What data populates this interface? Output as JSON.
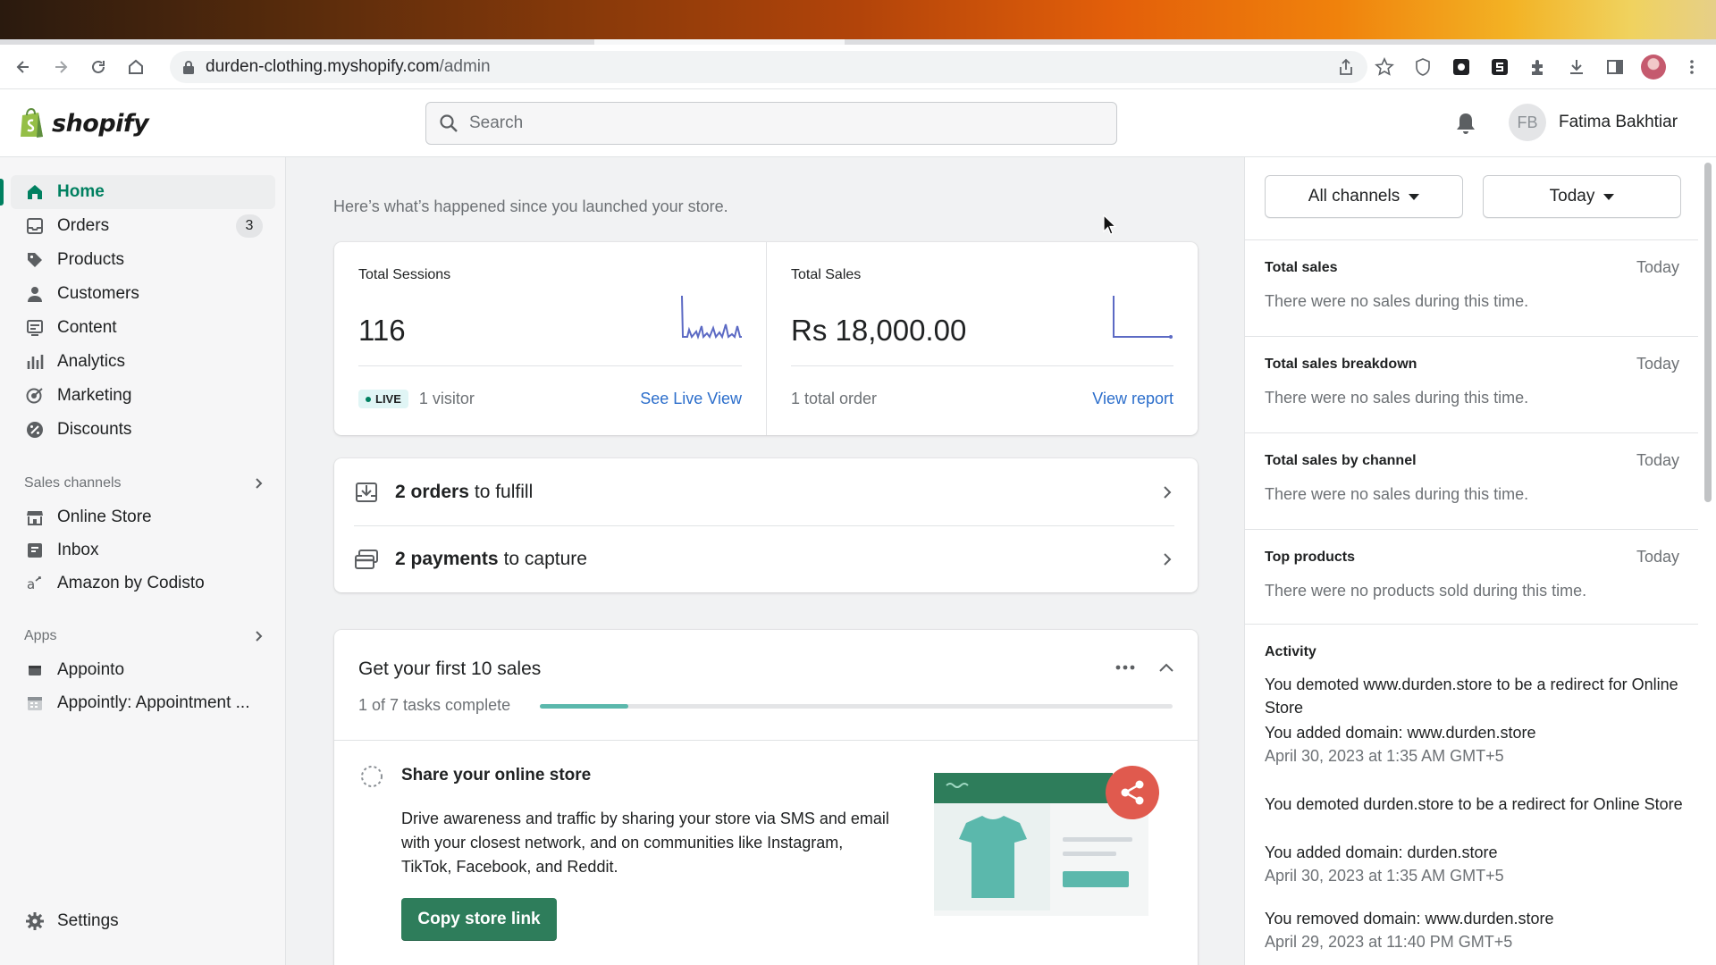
{
  "browser": {
    "url_host": "durden-clothing.myshopify.com",
    "url_path": "/admin"
  },
  "topbar": {
    "logo_text": "shopify",
    "search_placeholder": "Search",
    "user_initials": "FB",
    "user_name": "Fatima Bakhtiar"
  },
  "sidebar": {
    "items": [
      {
        "label": "Home",
        "icon": "home-icon",
        "active": true
      },
      {
        "label": "Orders",
        "icon": "orders-icon",
        "badge": "3"
      },
      {
        "label": "Products",
        "icon": "tag-icon"
      },
      {
        "label": "Customers",
        "icon": "person-icon"
      },
      {
        "label": "Content",
        "icon": "content-icon"
      },
      {
        "label": "Analytics",
        "icon": "bar-chart-icon"
      },
      {
        "label": "Marketing",
        "icon": "target-icon"
      },
      {
        "label": "Discounts",
        "icon": "discount-icon"
      }
    ],
    "sales_channels_heading": "Sales channels",
    "sales_channels": [
      {
        "label": "Online Store",
        "icon": "store-icon"
      },
      {
        "label": "Inbox",
        "icon": "inbox-icon"
      },
      {
        "label": "Amazon by Codisto",
        "icon": "amazon-icon"
      }
    ],
    "apps_heading": "Apps",
    "apps": [
      {
        "label": "Appointo",
        "icon": "app-icon"
      },
      {
        "label": "Appointly: Appointment ...",
        "icon": "app-calendar-icon"
      }
    ],
    "settings_label": "Settings"
  },
  "main": {
    "intro": "Here’s what’s happened since you launched your store.",
    "sessions": {
      "label": "Total Sessions",
      "value": "116",
      "live_badge": "LIVE",
      "visitors": "1 visitor",
      "link": "See Live View"
    },
    "sales": {
      "label": "Total Sales",
      "value": "Rs 18,000.00",
      "orders": "1 total order",
      "link": "View report"
    },
    "todos": [
      {
        "bold": "2 orders",
        "rest": "to fulfill"
      },
      {
        "bold": "2 payments",
        "rest": "to capture"
      }
    ],
    "setup": {
      "title": "Get your first 10 sales",
      "progress_label": "1 of 7 tasks complete",
      "progress_fraction": 0.14,
      "task_title": "Share your online store",
      "task_desc": "Drive awareness and traffic by sharing your store via SMS and email with your closest network, and on communities like Instagram, TikTok, Facebook, and Reddit.",
      "button": "Copy store link"
    }
  },
  "right_panel": {
    "channel_filter": "All channels",
    "date_filter": "Today",
    "sections": [
      {
        "title": "Total sales",
        "date": "Today",
        "message": "There were no sales during this time."
      },
      {
        "title": "Total sales breakdown",
        "date": "Today",
        "message": "There were no sales during this time."
      },
      {
        "title": "Total sales by channel",
        "date": "Today",
        "message": "There were no sales during this time."
      },
      {
        "title": "Top products",
        "date": "Today",
        "message": "There were no products sold during this time."
      }
    ],
    "activity_title": "Activity",
    "activity": [
      {
        "text": "You demoted www.durden.store to be a redirect for Online Store",
        "time": ""
      },
      {
        "text": "You added domain: www.durden.store",
        "time": "April 30, 2023 at 1:35 AM GMT+5"
      },
      {
        "text": "You demoted durden.store to be a redirect for Online Store",
        "time": ""
      },
      {
        "text": "You added domain: durden.store",
        "time": "April 30, 2023 at 1:35 AM GMT+5"
      },
      {
        "text": "You removed domain: www.durden.store",
        "time": "April 29, 2023 at 11:40 PM GMT+5"
      }
    ]
  },
  "colors": {
    "brand_green": "#008060",
    "button_green": "#2e7d5b",
    "link_blue": "#2c6ecb",
    "spark_purple": "#5c6ac4",
    "progress_teal": "#5bb8ac",
    "share_red": "#e05a4e"
  }
}
